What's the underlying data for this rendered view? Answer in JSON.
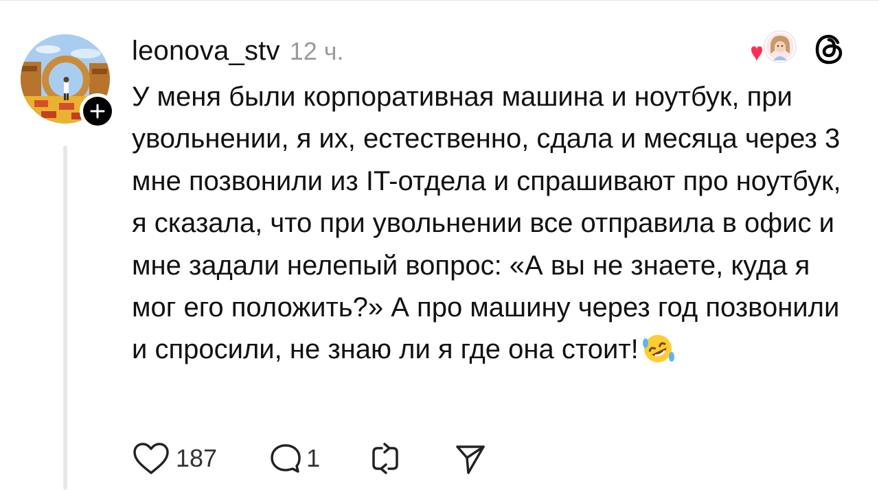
{
  "post": {
    "username": "leonova_stv",
    "time": "12 ч.",
    "text_before_emoji": "У меня были корпоративная машина и ноутбук, при увольнении, я их, естественно, сдала и месяца через 3 мне позвонили из IT-отдела и спрашивают про ноутбук, я сказала, что при увольнении все отправила в офис и мне задали нелепый вопрос: «А вы не знаете, куда я мог его положить?» А про машину через год позвонили и спросили, не знаю ли я где она стоит!",
    "emoji": "rolling-on-floor-laughing",
    "likes": "187",
    "replies": "1"
  },
  "icons": {
    "avatar": "profile-photo",
    "follow": "plus-icon",
    "liked_by": "heart-with-avatar",
    "logo": "threads-logo-icon",
    "like": "heart-outline-icon",
    "reply": "speech-bubble-icon",
    "repost": "repost-icon",
    "share": "send-icon"
  },
  "colors": {
    "text": "#111111",
    "muted": "#9a9a9a",
    "heart_red": "#ff2d55",
    "thread_line": "#e8e8e8"
  }
}
